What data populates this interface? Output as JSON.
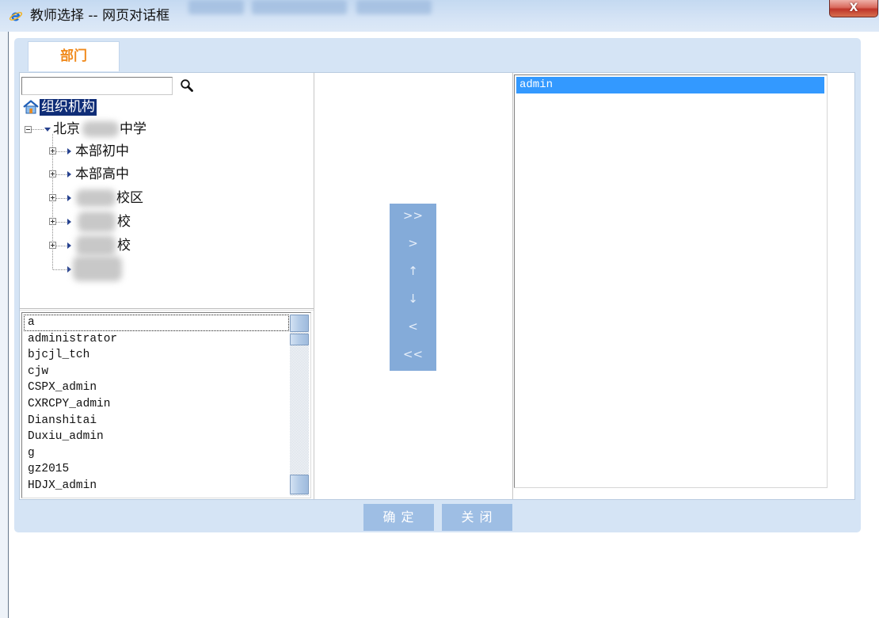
{
  "window": {
    "title": "教师选择 -- 网页对话框",
    "app_icon": "internet-explorer-icon",
    "close_label": "X"
  },
  "colors": {
    "panel_bg": "#d5e4f5",
    "tab_label": "#f08a1c",
    "tree_selection": "#0f2d77",
    "list_selection": "#3399ff",
    "transfer_bg": "#84abd9",
    "footer_button_bg": "#9ebee4"
  },
  "tabs": [
    {
      "label": "部门",
      "active": true
    }
  ],
  "search": {
    "icon": "magnifier-icon"
  },
  "tree": {
    "root": {
      "label": "组织机构",
      "icon": "home-icon",
      "selected": true
    },
    "school": {
      "label_start": "北京",
      "label_end": "中学",
      "expanded": true,
      "redacted": true
    },
    "campuses": [
      {
        "label": "本部初中",
        "expanded": false
      },
      {
        "label": "本部高中",
        "expanded": false
      },
      {
        "label": "校区",
        "expanded": false,
        "redacted": true
      },
      {
        "label": "校",
        "expanded": false,
        "redacted": true
      },
      {
        "label": "校",
        "expanded": false,
        "redacted": true
      },
      {
        "expandable": false,
        "redacted": true
      }
    ]
  },
  "available_users": {
    "items": [
      "a",
      "administrator",
      "bjcjl_tch",
      "cjw",
      "CSPX_admin",
      "CXRCPY_admin",
      "Dianshitai",
      "Duxiu_admin",
      "g",
      "gz2015",
      "HDJX_admin"
    ],
    "focused_index": 0
  },
  "transfer_buttons": [
    ">>",
    ">",
    "↑",
    "↓",
    "<",
    "<<"
  ],
  "selected_users": {
    "items": [
      "admin"
    ],
    "highlighted_index": 0
  },
  "footer": {
    "confirm_label": "确 定",
    "close_label": "关 闭"
  }
}
